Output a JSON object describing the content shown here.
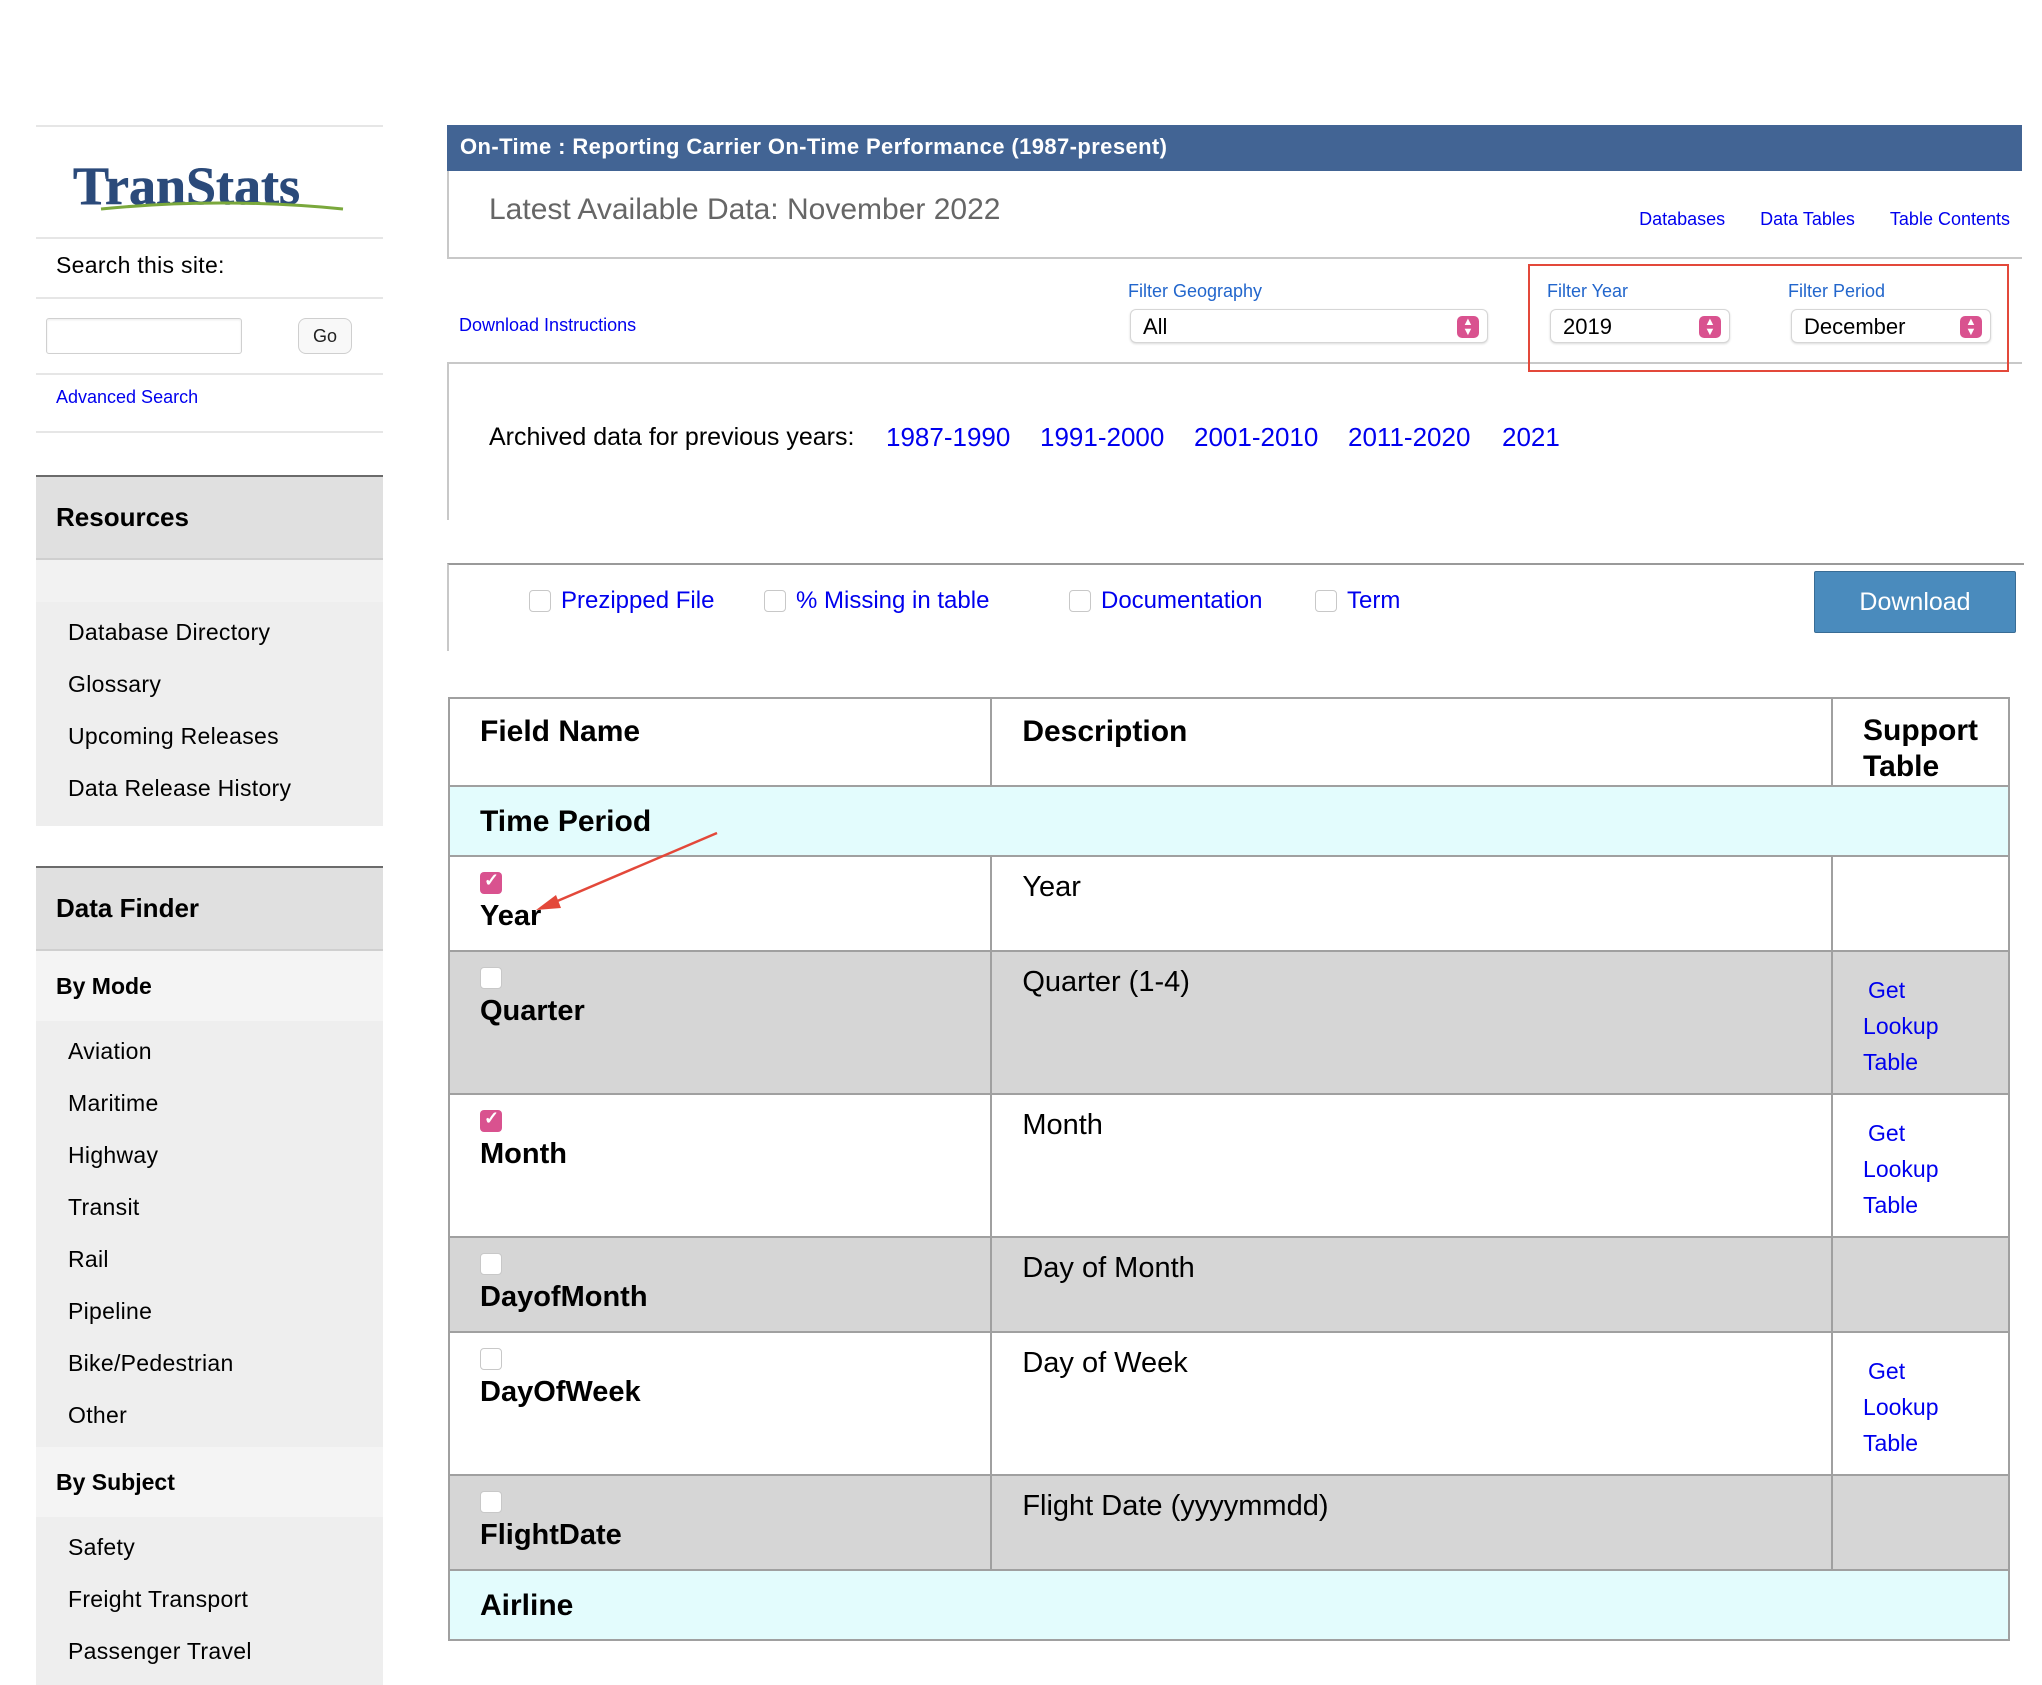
{
  "sidebar": {
    "logo_text": "TranStats",
    "search_label": "Search this site:",
    "search_value": "",
    "go_label": "Go",
    "advanced_search": "Advanced Search",
    "resources_title": "Resources",
    "resources_items": [
      "Database Directory",
      "Glossary",
      "Upcoming Releases",
      "Data Release History"
    ],
    "data_finder_title": "Data Finder",
    "by_mode_title": "By Mode",
    "by_mode_items": [
      "Aviation",
      "Maritime",
      "Highway",
      "Transit",
      "Rail",
      "Pipeline",
      "Bike/Pedestrian",
      "Other"
    ],
    "by_subject_title": "By Subject",
    "by_subject_items": [
      "Safety",
      "Freight Transport",
      "Passenger Travel"
    ]
  },
  "header": {
    "title": "On-Time : Reporting Carrier On-Time Performance (1987-present)",
    "latest": "Latest Available Data: November 2022",
    "links": [
      "Databases",
      "Data Tables",
      "Table Contents"
    ]
  },
  "filters": {
    "download_instructions": "Download Instructions",
    "geography_label": "Filter Geography",
    "geography_value": "All",
    "year_label": "Filter Year",
    "year_value": "2019",
    "period_label": "Filter Period",
    "period_value": "December"
  },
  "archive": {
    "label": "Archived data for previous years:",
    "ranges": [
      "1987-1990",
      "1991-2000",
      "2001-2010",
      "2011-2020",
      "2021"
    ]
  },
  "options": {
    "prezipped": "Prezipped File",
    "missing": "% Missing in table",
    "documentation": "Documentation",
    "term": "Term",
    "download": "Download"
  },
  "table": {
    "headers": [
      "Field Name",
      "Description",
      "Support Table"
    ],
    "groups": [
      "Time Period",
      "Airline"
    ],
    "support_link": [
      "Get",
      "Lookup",
      "Table"
    ],
    "rows": [
      {
        "name": "Year",
        "desc": "Year",
        "checked": true,
        "support": false
      },
      {
        "name": "Quarter",
        "desc": "Quarter (1-4)",
        "checked": false,
        "support": true
      },
      {
        "name": "Month",
        "desc": "Month",
        "checked": true,
        "support": true
      },
      {
        "name": "DayofMonth",
        "desc": "Day of Month",
        "checked": false,
        "support": false
      },
      {
        "name": "DayOfWeek",
        "desc": "Day of Week",
        "checked": false,
        "support": true
      },
      {
        "name": "FlightDate",
        "desc": "Flight Date (yyyymmdd)",
        "checked": false,
        "support": false
      }
    ]
  },
  "colors": {
    "title_bar": "#426494",
    "highlight_box": "#e3483a",
    "checkbox_checked": "#d9528f",
    "group_row": "#e3fcfd",
    "alt_row": "#d6d6d6",
    "link": "#0000ee"
  }
}
